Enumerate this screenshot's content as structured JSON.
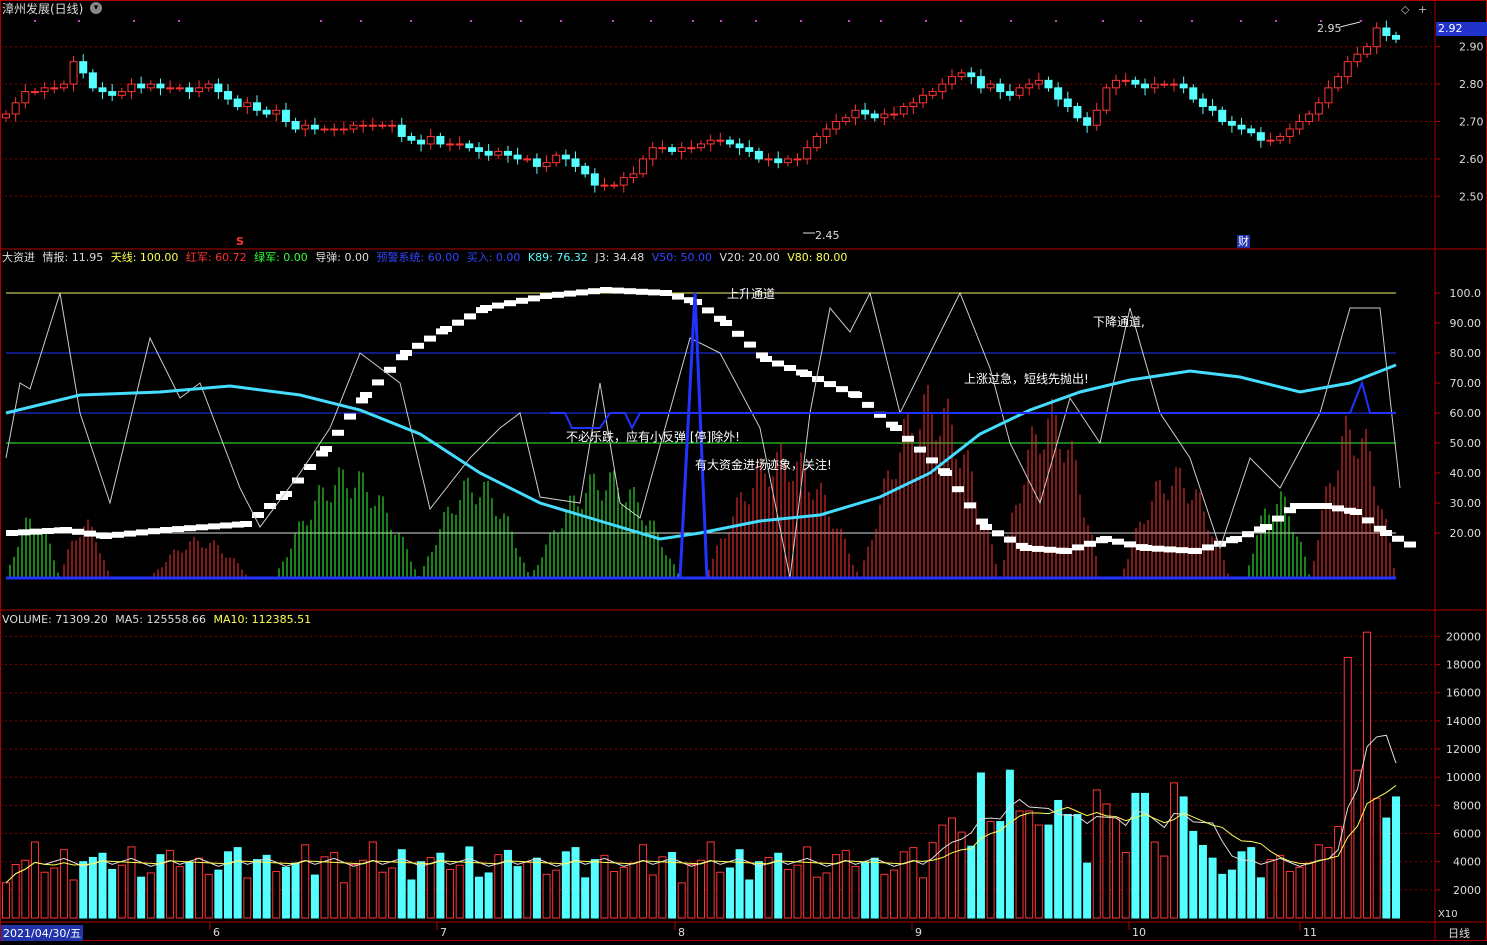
{
  "title": "漳州发展(日线)",
  "price_tag": "2.92",
  "price_axis": [
    "2.90",
    "2.80",
    "2.70",
    "2.60",
    "2.50"
  ],
  "annotations": {
    "high": "2.95",
    "low": "2.45",
    "marker_s": "S",
    "marker_cai": "财"
  },
  "ind_header": [
    {
      "text": "大资进",
      "color": "#dddddd"
    },
    {
      "text": "情报: 11.95",
      "color": "#dddddd"
    },
    {
      "text": "天线: 100.00",
      "color": "#ffff55"
    },
    {
      "text": "红军: 60.72",
      "color": "#ff3333"
    },
    {
      "text": "绿军: 0.00",
      "color": "#33ff33"
    },
    {
      "text": "导弹: 0.00",
      "color": "#dddddd"
    },
    {
      "text": "预警系统: 60.00",
      "color": "#3344ff"
    },
    {
      "text": "买入: 0.00",
      "color": "#3344ff"
    },
    {
      "text": "K89: 76.32",
      "color": "#55ffff"
    },
    {
      "text": "J3: 34.48",
      "color": "#dddddd"
    },
    {
      "text": "V50: 50.00",
      "color": "#3344ff"
    },
    {
      "text": "V20: 20.00",
      "color": "#dddddd"
    },
    {
      "text": "V80: 80.00",
      "color": "#ffff55"
    }
  ],
  "ind_axis": [
    "100.0",
    "90.00",
    "80.00",
    "70.00",
    "60.00",
    "50.00",
    "40.00",
    "30.00",
    "20.00"
  ],
  "ind_texts": {
    "up_channel": "上升通道",
    "down_channel": "下降通道,",
    "overheat": "上涨过急，短线先抛出!",
    "rebound": "不必乐跌，应有小反弹 [停]除外!",
    "funds": "有大资金进场迹象，关注!"
  },
  "vol_header": [
    {
      "text": "VOLUME: 71309.20",
      "color": "#dddddd"
    },
    {
      "text": "MA5: 125558.66",
      "color": "#dddddd"
    },
    {
      "text": "MA10: 112385.51",
      "color": "#ffff55"
    }
  ],
  "vol_axis": [
    "20000",
    "18000",
    "16000",
    "14000",
    "12000",
    "10000",
    "8000",
    "6000",
    "4000",
    "2000"
  ],
  "vol_unit": "X10",
  "date_axis": {
    "start": "2021/04/30/五",
    "labels": [
      "6",
      "7",
      "8",
      "9",
      "10",
      "11"
    ],
    "period": "日线"
  },
  "colors": {
    "up": "#ff3333",
    "down": "#55ffff",
    "grid": "#8b0000",
    "frame": "#b00000",
    "white": "#ffffff",
    "blue": "#2233ff",
    "cyan": "#44ddff",
    "green": "#33ff33",
    "yellow": "#ffff55"
  },
  "chart_data": {
    "type": "candlestick",
    "ylim": [
      2.45,
      2.95
    ],
    "candles_close": [
      2.72,
      2.75,
      2.78,
      2.78,
      2.79,
      2.79,
      2.8,
      2.86,
      2.83,
      2.79,
      2.78,
      2.77,
      2.78,
      2.8,
      2.79,
      2.8,
      2.79,
      2.79,
      2.79,
      2.78,
      2.79,
      2.8,
      2.78,
      2.76,
      2.74,
      2.75,
      2.73,
      2.72,
      2.73,
      2.7,
      2.68,
      2.69,
      2.68,
      2.68,
      2.68,
      2.68,
      2.69,
      2.69,
      2.69,
      2.69,
      2.69,
      2.66,
      2.65,
      2.64,
      2.66,
      2.64,
      2.64,
      2.64,
      2.63,
      2.62,
      2.61,
      2.62,
      2.61,
      2.6,
      2.6,
      2.58,
      2.59,
      2.61,
      2.6,
      2.58,
      2.56,
      2.53,
      2.53,
      2.53,
      2.55,
      2.56,
      2.6,
      2.63,
      2.63,
      2.62,
      2.63,
      2.63,
      2.64,
      2.65,
      2.65,
      2.64,
      2.63,
      2.62,
      2.6,
      2.6,
      2.59,
      2.6,
      2.6,
      2.63,
      2.66,
      2.68,
      2.7,
      2.71,
      2.73,
      2.72,
      2.71,
      2.72,
      2.72,
      2.74,
      2.75,
      2.77,
      2.78,
      2.8,
      2.82,
      2.83,
      2.82,
      2.79,
      2.8,
      2.78,
      2.77,
      2.79,
      2.8,
      2.81,
      2.79,
      2.76,
      2.74,
      2.71,
      2.69,
      2.73,
      2.79,
      2.81,
      2.81,
      2.8,
      2.79,
      2.8,
      2.8,
      2.8,
      2.79,
      2.76,
      2.74,
      2.73,
      2.7,
      2.69,
      2.68,
      2.67,
      2.65,
      2.65,
      2.66,
      2.68,
      2.7,
      2.72,
      2.75,
      2.79,
      2.82,
      2.86,
      2.88,
      2.9,
      2.95,
      2.93,
      2.92
    ]
  }
}
